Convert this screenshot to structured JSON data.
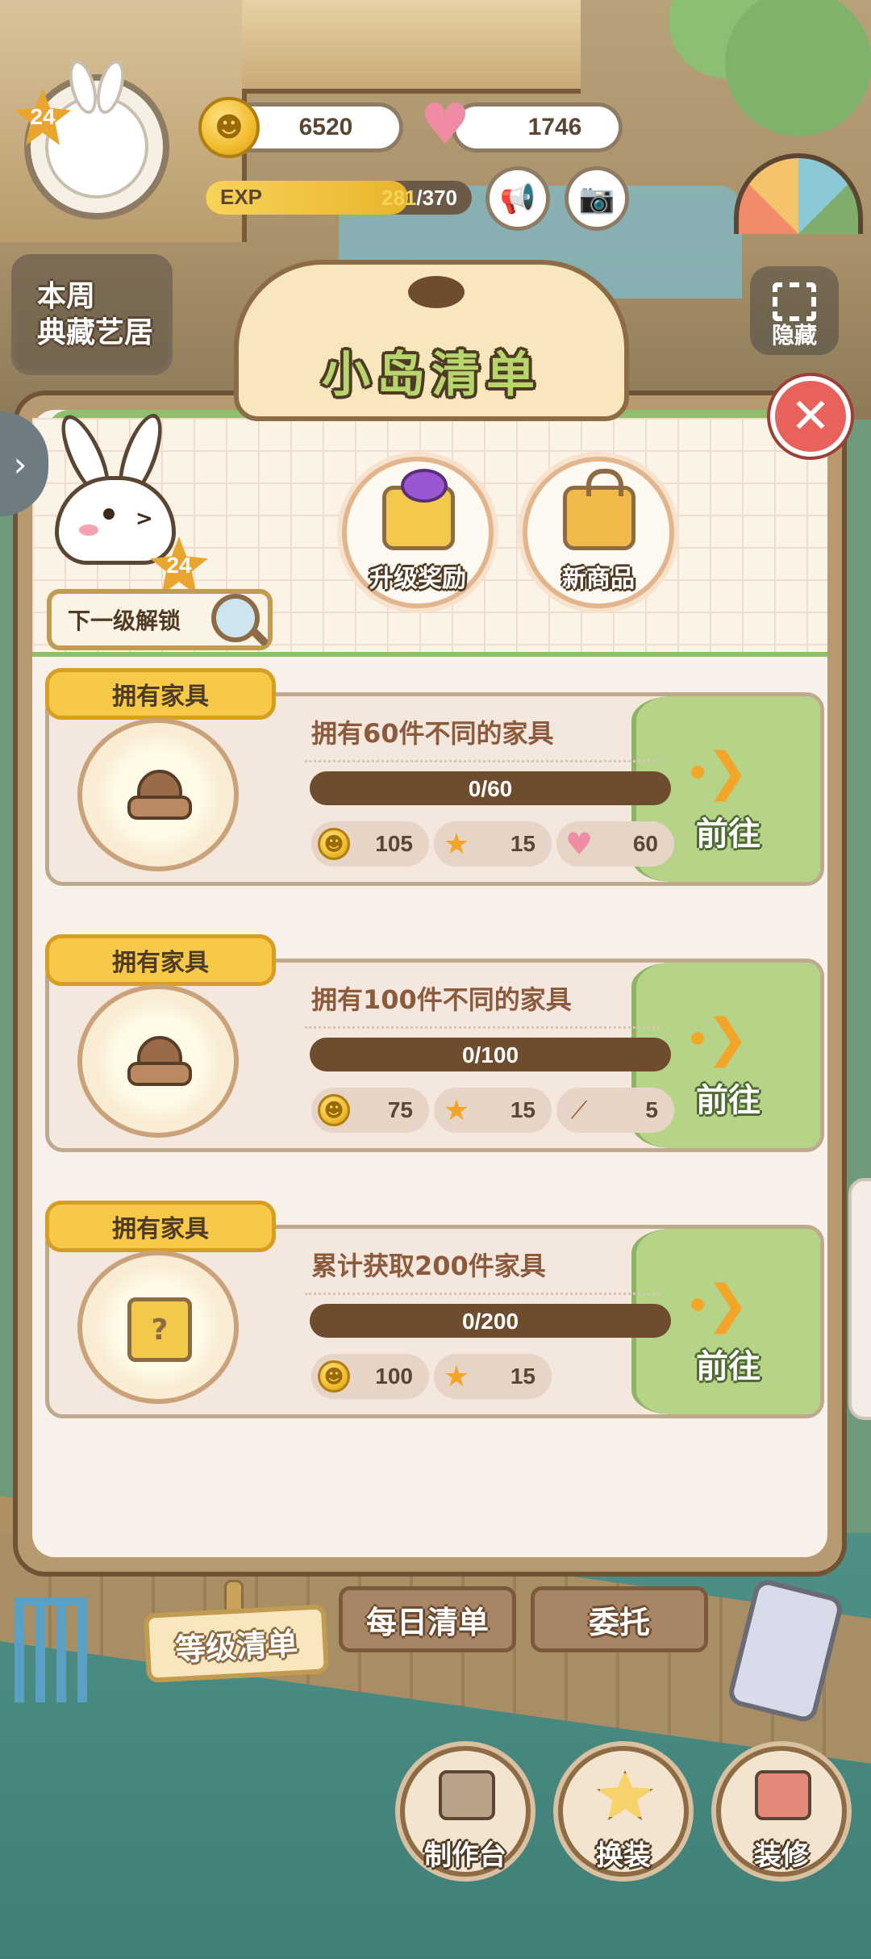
{
  "hud": {
    "level": "24",
    "coins": "6520",
    "hearts": "1746",
    "exp_label": "EXP",
    "exp_current": "281",
    "exp_max": "/370",
    "exp_fraction": 0.76,
    "weekly_line1": "本周",
    "weekly_line2": "典藏艺居",
    "hide_label": "隐藏"
  },
  "dialog": {
    "title": "小岛清单",
    "mascot_level": "24",
    "next_level_unlock": "下一级解锁",
    "upgrade_reward": "升级奖励",
    "new_items": "新商品"
  },
  "tasks": [
    {
      "tag": "拥有家具",
      "title": "拥有60件不同的家具",
      "progress_text": "0/60",
      "progress_fraction": 0,
      "go_label": "前往",
      "rewards": [
        {
          "icon": "coin-icon",
          "value": "105"
        },
        {
          "icon": "star-icon",
          "value": "15"
        },
        {
          "icon": "heart-icon",
          "value": "60"
        }
      ]
    },
    {
      "tag": "拥有家具",
      "title": "拥有100件不同的家具",
      "progress_text": "0/100",
      "progress_fraction": 0,
      "go_label": "前往",
      "rewards": [
        {
          "icon": "coin-icon",
          "value": "75"
        },
        {
          "icon": "star-icon",
          "value": "15"
        },
        {
          "icon": "branch-icon",
          "value": "5"
        }
      ]
    },
    {
      "tag": "拥有家具",
      "title": "累计获取200件家具",
      "progress_text": "0/200",
      "progress_fraction": 0,
      "go_label": "前往",
      "rewards": [
        {
          "icon": "coin-icon",
          "value": "100"
        },
        {
          "icon": "star-icon",
          "value": "15"
        }
      ]
    }
  ],
  "tabs": {
    "level_list": "等级清单",
    "daily_list": "每日清单",
    "commission": "委托"
  },
  "actions": {
    "workbench": "制作台",
    "outfit": "换装",
    "decorate": "装修"
  },
  "colors": {
    "accent_green": "#b5d488",
    "accent_yellow": "#f6c948",
    "panel_brown": "#6e5336"
  }
}
